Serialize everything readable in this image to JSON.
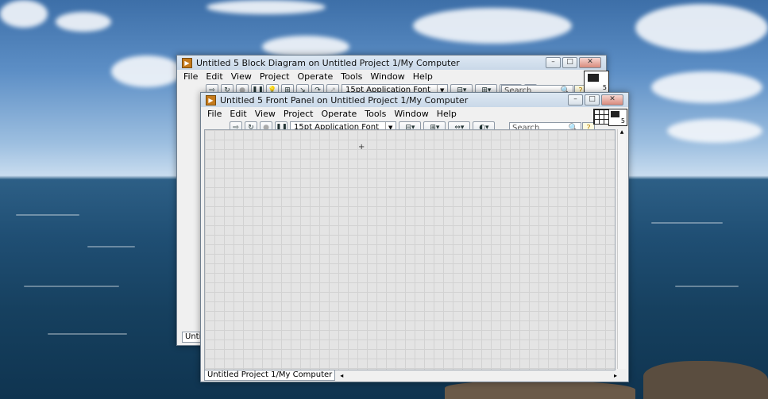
{
  "block_diagram": {
    "title": "Untitled 5 Block Diagram on Untitled Project 1/My Computer",
    "menu": [
      "File",
      "Edit",
      "View",
      "Project",
      "Operate",
      "Tools",
      "Window",
      "Help"
    ],
    "font_label": "15pt Application Font",
    "search_placeholder": "Search",
    "status_label": "Untitle"
  },
  "front_panel": {
    "title": "Untitled 5 Front Panel on Untitled Project 1/My Computer",
    "menu": [
      "File",
      "Edit",
      "View",
      "Project",
      "Operate",
      "Tools",
      "Window",
      "Help"
    ],
    "font_label": "15pt Application Font",
    "search_placeholder": "Search",
    "status_label": "Untitled Project 1/My Computer",
    "icon_number": "5"
  },
  "colors": {
    "panel_bg": "#e4e4e4",
    "grid_line": "#d2d2d2",
    "title_icon": "#c47a1c"
  }
}
